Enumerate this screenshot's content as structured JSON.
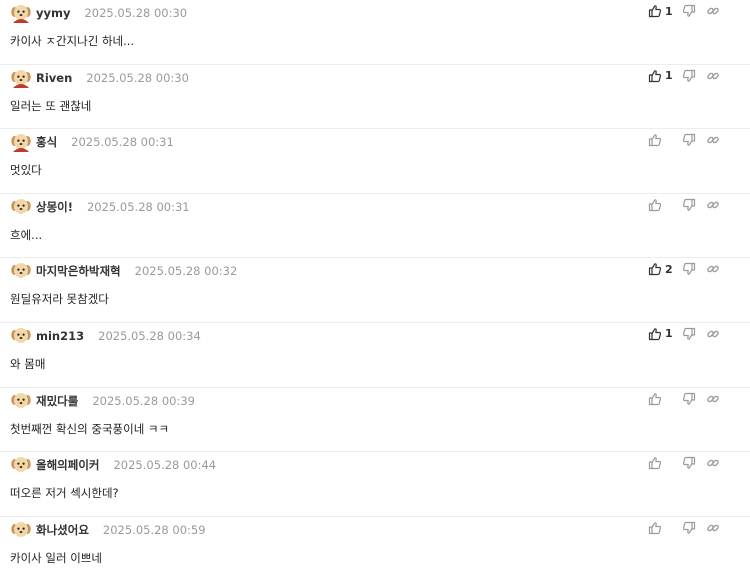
{
  "comments": [
    {
      "author": "yymy",
      "date": "2025.05.28 00:30",
      "text": "카이사 ㅈ간지나긴 하네...",
      "likes": "1",
      "avatar": "red"
    },
    {
      "author": "Riven",
      "date": "2025.05.28 00:30",
      "text": "일러는 또 괜찮네",
      "likes": "1",
      "avatar": "red"
    },
    {
      "author": "홍식",
      "date": "2025.05.28 00:31",
      "text": "멋있다",
      "likes": "",
      "avatar": "red"
    },
    {
      "author": "상몽이!",
      "date": "2025.05.28 00:31",
      "text": "흐에...",
      "likes": "",
      "avatar": "plain"
    },
    {
      "author": "마지막은하박재혁",
      "date": "2025.05.28 00:32",
      "text": "원딜유저라 못참겠다",
      "likes": "2",
      "avatar": "plain"
    },
    {
      "author": "min213",
      "date": "2025.05.28 00:34",
      "text": "와 몸매",
      "likes": "1",
      "avatar": "plain"
    },
    {
      "author": "재밌다룰",
      "date": "2025.05.28 00:39",
      "text": "첫번째껀 확신의 중국풍이네 ㅋㅋ",
      "likes": "",
      "avatar": "plain"
    },
    {
      "author": "올해의페이커",
      "date": "2025.05.28 00:44",
      "text": "떠오른 저거 섹시한데?",
      "likes": "",
      "avatar": "plain"
    },
    {
      "author": "화나셨어요",
      "date": "2025.05.28 00:59",
      "text": "카이사 일러 이쁘네",
      "likes": "",
      "avatar": "plain"
    }
  ],
  "icons": {
    "like": "thumbs-up-icon",
    "dislike": "thumbs-down-icon",
    "share": "link-icon"
  },
  "colors": {
    "divider": "#ececec",
    "date": "#9a9a9a",
    "icon": "#9a9a9a",
    "like_active": "#333333",
    "avatar_fur": "#f3d7a8",
    "avatar_ear": "#c99557",
    "avatar_red": "#c0392b"
  }
}
